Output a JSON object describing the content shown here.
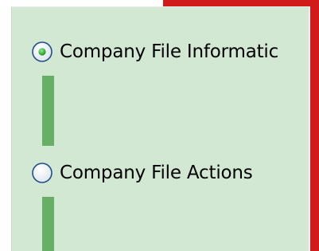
{
  "wizard": {
    "steps": [
      {
        "label": "Company File Informatic",
        "selected": true
      },
      {
        "label": "Company File Actions",
        "selected": false
      }
    ]
  },
  "colors": {
    "panel_background": "#d3e8d3",
    "connector": "#66b066",
    "frame_accent": "#d11b1b",
    "radio_dot": "#2fbe2f"
  }
}
